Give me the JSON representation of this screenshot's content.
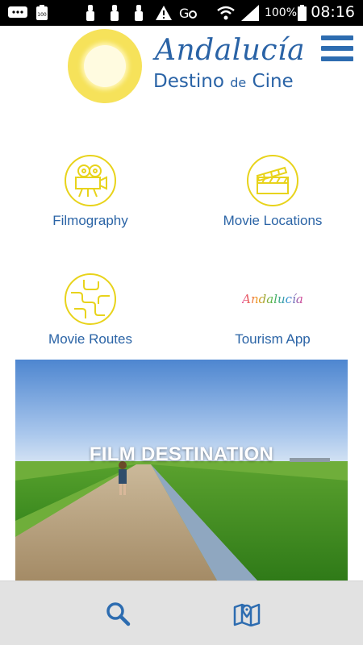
{
  "status_bar": {
    "battery_percent": "100%",
    "time": "08:16",
    "icons": [
      "chat-icon",
      "battery-100-icon",
      "usb-icon",
      "usb-icon",
      "usb-icon",
      "warning-icon",
      "gps-icon",
      "wifi-icon",
      "signal-icon",
      "battery-icon"
    ]
  },
  "header": {
    "logo_title": "Andalucía",
    "logo_subtitle_main": "Destino",
    "logo_subtitle_de": "de",
    "logo_subtitle_end": "Cine",
    "menu_icon": "hamburger-menu-icon"
  },
  "tiles": [
    {
      "label": "Filmography",
      "icon": "film-projector-icon"
    },
    {
      "label": "Movie Locations",
      "icon": "clapperboard-icon"
    },
    {
      "label": "Movie Routes",
      "icon": "route-map-icon"
    },
    {
      "label": "Tourism App",
      "icon": "andalucia-logo",
      "logo_text": "Andalucía"
    }
  ],
  "banner": {
    "title": "FILM DESTINATION"
  },
  "bottom_nav": {
    "search_icon": "search-icon",
    "map_icon": "map-pin-icon"
  },
  "colors": {
    "brand_blue": "#2b64a6",
    "accent_yellow": "#e8d31b",
    "bottom_bar": "#e2e2e2"
  }
}
